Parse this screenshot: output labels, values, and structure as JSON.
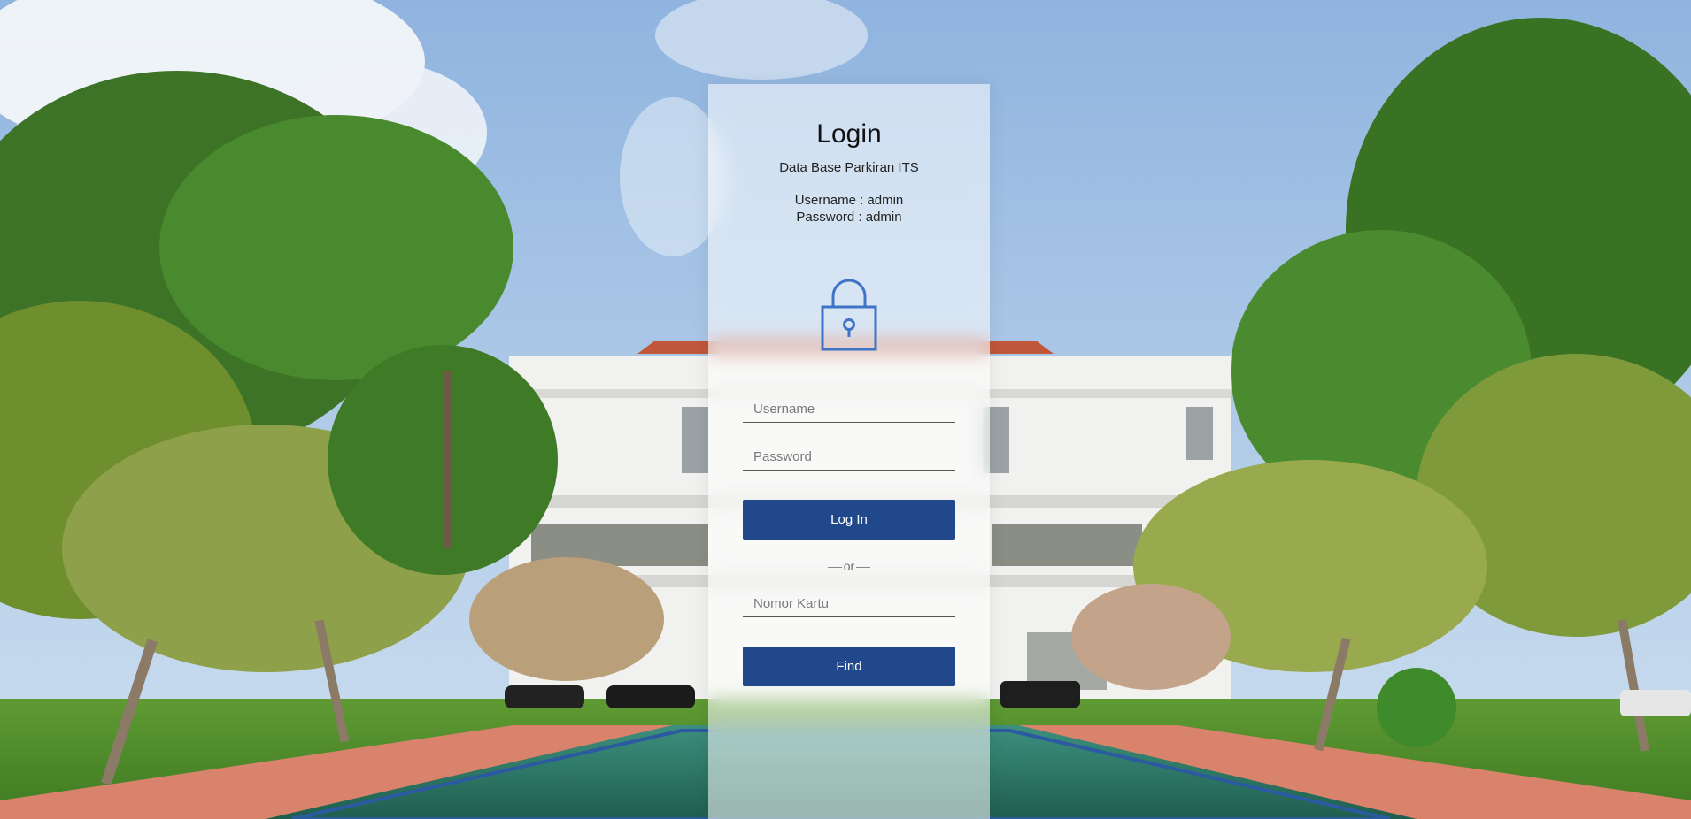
{
  "login": {
    "title": "Login",
    "subtitle": "Data Base Parkiran ITS",
    "username_hint": "Username : admin",
    "password_hint": "Password : admin",
    "username_placeholder": "Username",
    "password_placeholder": "Password",
    "login_button": "Log In",
    "separator": "or",
    "card_placeholder": "Nomor Kartu",
    "find_button": "Find"
  },
  "colors": {
    "button": "#20488a",
    "lock_icon": "#3f73c8",
    "sky": "#a9c6e6",
    "foliage": "#3f7a2a",
    "roof": "#c8573b"
  },
  "icons": {
    "lock": "lock-icon"
  }
}
